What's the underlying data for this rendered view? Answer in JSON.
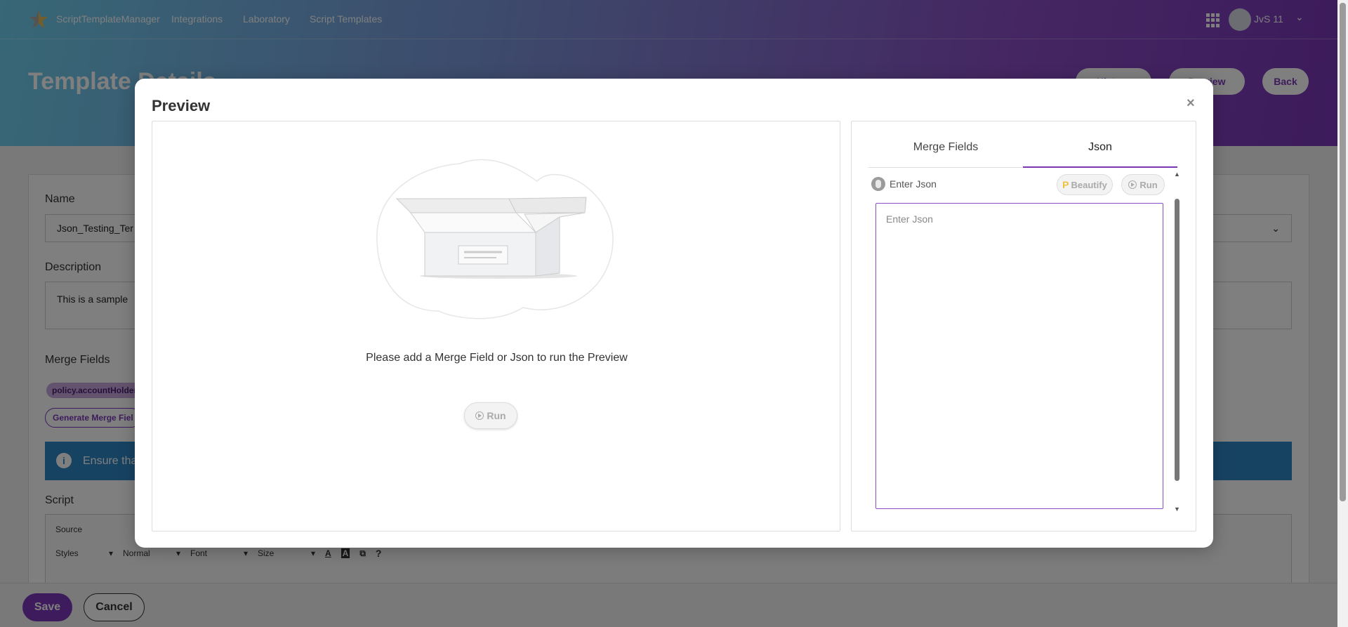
{
  "app": {
    "brand": "ScriptTemplateManager",
    "nav": [
      "Integrations",
      "Laboratory",
      "Script Templates"
    ],
    "user": "JvS 11"
  },
  "page": {
    "title": "Template Details",
    "header_buttons": {
      "history": "History",
      "preview": "Preview",
      "back": "Back"
    }
  },
  "form": {
    "name_label": "Name",
    "name_value": "Json_Testing_Ter",
    "description_label": "Description",
    "description_value": "This is a sample",
    "merge_fields_label": "Merge Fields",
    "chip": "policy.accountHolder",
    "generate_button": "Generate  Merge Fiel",
    "alert_text": "Ensure tha",
    "script_label": "Script",
    "editor": {
      "source": "Source",
      "styles": "Styles",
      "format": "Normal",
      "font": "Font",
      "size": "Size",
      "help": "?"
    }
  },
  "footer": {
    "save": "Save",
    "cancel": "Cancel"
  },
  "modal": {
    "title": "Preview",
    "close": "×",
    "empty_message": "Please add a Merge Field or Json to run the Preview",
    "run": "Run",
    "tabs": [
      "Merge Fields",
      "Json"
    ],
    "active_tab": "Json",
    "json_label": "Enter Json",
    "beautify": "Beautify",
    "json_placeholder": "Enter Json"
  },
  "colors": {
    "accent": "#7a36b8",
    "alert": "#2f86c6"
  }
}
